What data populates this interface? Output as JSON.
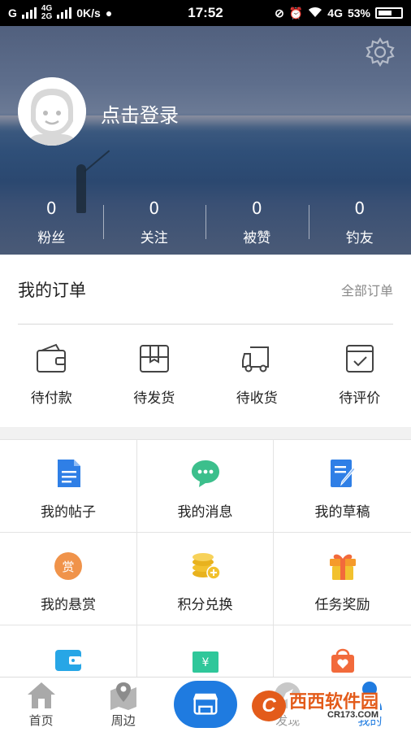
{
  "status_bar": {
    "carrier_left": "G",
    "net_top": "4G",
    "net_bottom": "2G",
    "speed": "0K/s",
    "time": "17:52",
    "net_right": "4G",
    "battery": "53%"
  },
  "profile": {
    "login_label": "点击登录",
    "stats": [
      {
        "value": "0",
        "label": "粉丝"
      },
      {
        "value": "0",
        "label": "关注"
      },
      {
        "value": "0",
        "label": "被赞"
      },
      {
        "value": "0",
        "label": "钓友"
      }
    ]
  },
  "orders": {
    "title": "我的订单",
    "all_link": "全部订单",
    "items": [
      {
        "label": "待付款",
        "icon": "wallet-icon"
      },
      {
        "label": "待发货",
        "icon": "box-icon"
      },
      {
        "label": "待收货",
        "icon": "truck-icon"
      },
      {
        "label": "待评价",
        "icon": "review-icon"
      }
    ]
  },
  "menu": {
    "items": [
      {
        "label": "我的帖子",
        "icon": "document-icon"
      },
      {
        "label": "我的消息",
        "icon": "chat-icon"
      },
      {
        "label": "我的草稿",
        "icon": "draft-icon"
      },
      {
        "label": "我的悬赏",
        "icon": "reward-icon",
        "badge": "赏"
      },
      {
        "label": "积分兑换",
        "icon": "coins-icon"
      },
      {
        "label": "任务奖励",
        "icon": "gift-icon"
      }
    ]
  },
  "tab_bar": {
    "items": [
      {
        "label": "首页",
        "icon": "home-icon"
      },
      {
        "label": "周边",
        "icon": "map-pin-icon"
      },
      {
        "label": "",
        "icon": "store-icon"
      },
      {
        "label": "发现",
        "icon": "compass-icon"
      },
      {
        "label": "我的",
        "icon": "user-icon"
      }
    ]
  },
  "watermark": {
    "brand": "西西软件园",
    "url": "CR173.COM",
    "logo_letter": "C"
  },
  "colors": {
    "accent": "#1f7be0",
    "stat_text": "#ffffff",
    "muted": "#8a8a8a"
  }
}
